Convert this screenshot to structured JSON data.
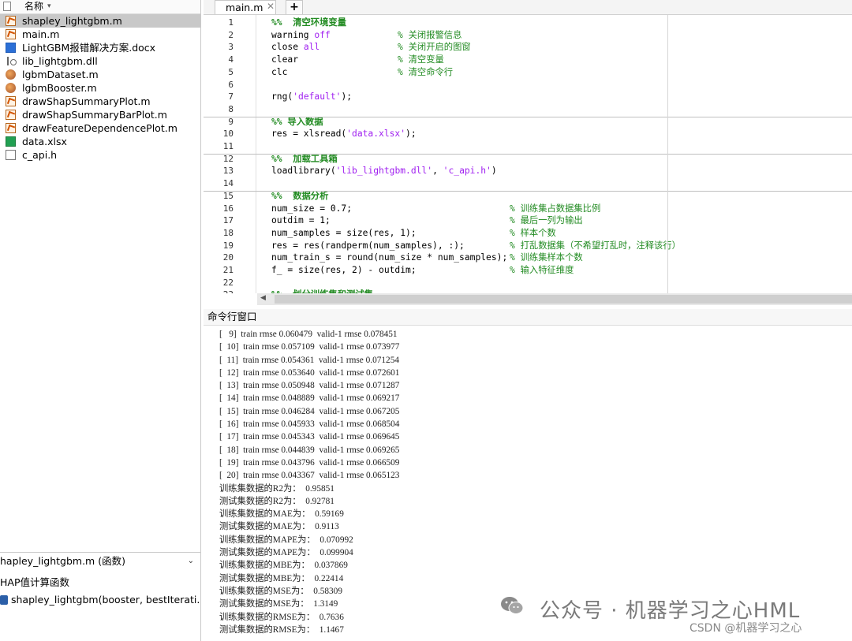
{
  "file_browser": {
    "header": "名称",
    "files": [
      {
        "name": "shapley_lightgbm.m",
        "icon": "m-file-icon",
        "selected": true
      },
      {
        "name": "main.m",
        "icon": "m-file-icon"
      },
      {
        "name": "LightGBM报错解决方案.docx",
        "icon": "word-doc-icon"
      },
      {
        "name": "lib_lightgbm.dll",
        "icon": "dll-file-icon"
      },
      {
        "name": "lgbmDataset.m",
        "icon": "class-file-icon"
      },
      {
        "name": "lgbmBooster.m",
        "icon": "class-file-icon"
      },
      {
        "name": "drawShapSummaryPlot.m",
        "icon": "m-file-icon"
      },
      {
        "name": "drawShapSummaryBarPlot.m",
        "icon": "m-file-icon"
      },
      {
        "name": "drawFeatureDependencePlot.m",
        "icon": "m-file-icon"
      },
      {
        "name": "data.xlsx",
        "icon": "excel-file-icon"
      },
      {
        "name": "c_api.h",
        "icon": "header-file-icon"
      }
    ],
    "details": {
      "selected": "hapley_lightgbm.m (函数)",
      "description": "HAP值计算函数",
      "function_signature": "shapley_lightgbm(booster, bestIterati..."
    }
  },
  "editor": {
    "tab": {
      "label": "main.m",
      "close": "✕",
      "add": "+"
    },
    "lines": [
      {
        "no": "1",
        "code": "%%  清空环境变量",
        "kind": "section"
      },
      {
        "no": "2",
        "code": "warning ",
        "kw": "off",
        "comment": "% 关闭报警信息"
      },
      {
        "no": "3",
        "code": "close ",
        "kw": "all",
        "comment": "% 关闭开启的图窗"
      },
      {
        "no": "4",
        "code": "clear",
        "comment": "% 清空变量"
      },
      {
        "no": "5",
        "code": "clc",
        "comment": "% 清空命令行"
      },
      {
        "no": "6",
        "code": ""
      },
      {
        "no": "7",
        "code": "rng(",
        "kw": "'default'",
        "tail": ");"
      },
      {
        "no": "8",
        "code": ""
      },
      {
        "no": "9",
        "code": "%% 导入数据",
        "kind": "section"
      },
      {
        "no": "10",
        "code": "res = xlsread(",
        "kw": "'data.xlsx'",
        "tail": ");"
      },
      {
        "no": "11",
        "code": ""
      },
      {
        "no": "12",
        "code": "%%  加载工具箱",
        "kind": "section"
      },
      {
        "no": "13",
        "code": "loadlibrary(",
        "kw": "'lib_lightgbm.dll'",
        "tail": ", ",
        "kw2": "'c_api.h'",
        "tail2": ")"
      },
      {
        "no": "14",
        "code": ""
      },
      {
        "no": "15",
        "code": "%%  数据分析",
        "kind": "section"
      },
      {
        "no": "16",
        "code": "num_size = 0.7;",
        "comment2": "% 训练集占数据集比例"
      },
      {
        "no": "17",
        "code": "outdim = 1;",
        "comment2": "% 最后一列为输出"
      },
      {
        "no": "18",
        "code": "num_samples = size(res, 1);",
        "comment2": "% 样本个数"
      },
      {
        "no": "19",
        "code": "res = res(randperm(num_samples), :);",
        "comment2": "% 打乱数据集（不希望打乱时，注释该行）"
      },
      {
        "no": "20",
        "code": "num_train_s = round(num_size * num_samples);",
        "comment2": "% 训练集样本个数"
      },
      {
        "no": "21",
        "code": "f_ = size(res, 2) - outdim;",
        "comment2": "% 输入特征维度"
      },
      {
        "no": "22",
        "code": ""
      },
      {
        "no": "23",
        "code": "%%  划分训练集和测试集",
        "kind": "section"
      }
    ]
  },
  "command_window": {
    "title": "命令行窗口",
    "lines": [
      "[   9]  train rmse 0.060479  valid-1 rmse 0.078451",
      "[  10]  train rmse 0.057109  valid-1 rmse 0.073977",
      "[  11]  train rmse 0.054361  valid-1 rmse 0.071254",
      "[  12]  train rmse 0.053640  valid-1 rmse 0.072601",
      "[  13]  train rmse 0.050948  valid-1 rmse 0.071287",
      "[  14]  train rmse 0.048889  valid-1 rmse 0.069217",
      "[  15]  train rmse 0.046284  valid-1 rmse 0.067205",
      "[  16]  train rmse 0.045933  valid-1 rmse 0.068504",
      "[  17]  train rmse 0.045343  valid-1 rmse 0.069645",
      "[  18]  train rmse 0.044839  valid-1 rmse 0.069265",
      "[  19]  train rmse 0.043796  valid-1 rmse 0.066509",
      "[  20]  train rmse 0.043367  valid-1 rmse 0.065123",
      "训练集数据的R2为：  0.95851",
      "测试集数据的R2为：  0.92781",
      "训练集数据的MAE为：  0.59169",
      "测试集数据的MAE为：  0.9113",
      "训练集数据的MAPE为：  0.070992",
      "测试集数据的MAPE为：  0.099904",
      "训练集数据的MBE为：  0.037869",
      "测试集数据的MBE为：  0.22414",
      "训练集数据的MSE为：  0.58309",
      "测试集数据的MSE为：  1.3149",
      "训练集数据的RMSE为：  0.7636",
      "测试集数据的RMSE为：  1.1467"
    ]
  },
  "watermark": {
    "text": "公众号 · 机器学习之心HML",
    "csdn": "CSDN @机器学习之心"
  }
}
